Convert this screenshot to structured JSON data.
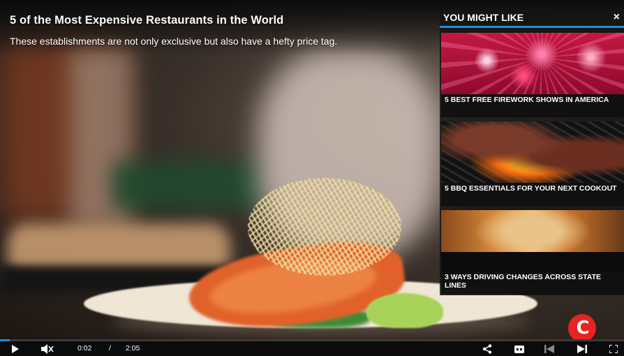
{
  "video": {
    "title": "5 of the Most Expensive Restaurants in the World",
    "subtitle": "These establishments are not only exclusive but also have a hefty price tag.",
    "progress_fraction": 0.016
  },
  "recommendations": {
    "heading": "YOU MIGHT LIKE",
    "close_glyph": "×",
    "items": [
      {
        "label": "5 BEST FREE FIREWORK SHOWS IN AMERICA"
      },
      {
        "label": "5 BBQ ESSENTIALS FOR YOUR NEXT COOKOUT"
      },
      {
        "label": "3 WAYS DRIVING CHANGES ACROSS STATE LINES"
      }
    ]
  },
  "controls": {
    "current_time": "0:02",
    "separator": "/",
    "duration": "2:05",
    "icons": [
      "play-icon",
      "mute-icon",
      "share-icon",
      "captions-icon",
      "previous-icon",
      "next-icon",
      "fullscreen-icon"
    ]
  },
  "brand": {
    "badge_letter": "C",
    "accent": "#1b8fd6",
    "badge_color": "#e62424"
  }
}
